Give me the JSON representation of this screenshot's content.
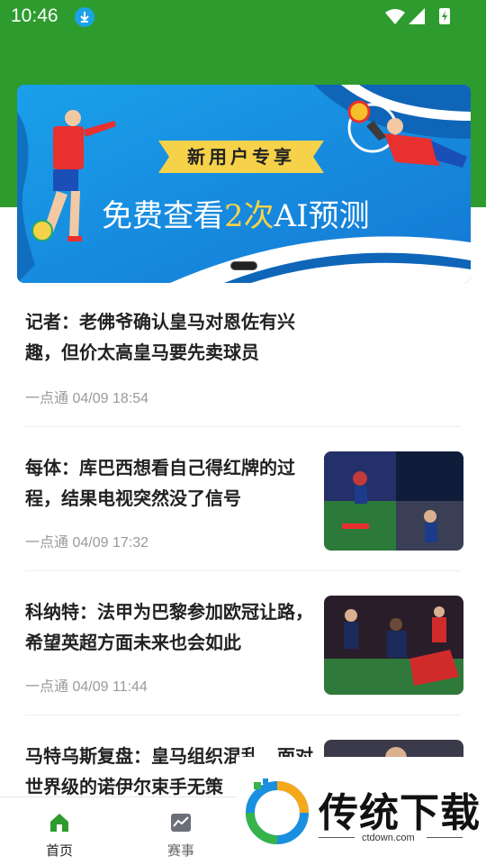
{
  "status_bar": {
    "time": "10:46"
  },
  "banner": {
    "tag": "新用户专享",
    "headline_pre": "免费查看",
    "headline_highlight": "2次",
    "headline_post": "AI预测",
    "page_count": 1,
    "current_page": 1
  },
  "news": [
    {
      "title": "记者：老佛爷确认皇马对恩佐有兴趣，但价太高皇马要先卖球员",
      "source": "一点通",
      "datetime": "04/09 18:54"
    },
    {
      "title": "每体：库巴西想看自己得红牌的过程，结果电视突然没了信号",
      "source": "一点通",
      "datetime": "04/09 17:32"
    },
    {
      "title": "科纳特：法甲为巴黎参加欧冠让路，希望英超方面未来也会如此",
      "source": "一点通",
      "datetime": "04/09 11:44"
    },
    {
      "title": "马特乌斯复盘：皇马组织混乱，面对世界级的诺伊尔束手无策",
      "source": "",
      "datetime": ""
    }
  ],
  "bottom_nav": {
    "items": [
      {
        "label": "首页",
        "active": true
      },
      {
        "label": "赛事",
        "active": false
      }
    ]
  },
  "watermark": {
    "brand": "传统下载",
    "url": "ctdown.com"
  },
  "colors": {
    "brand_green": "#2e9b2e",
    "banner_blue": "#1a8fe0",
    "highlight_yellow": "#f6d24a"
  }
}
